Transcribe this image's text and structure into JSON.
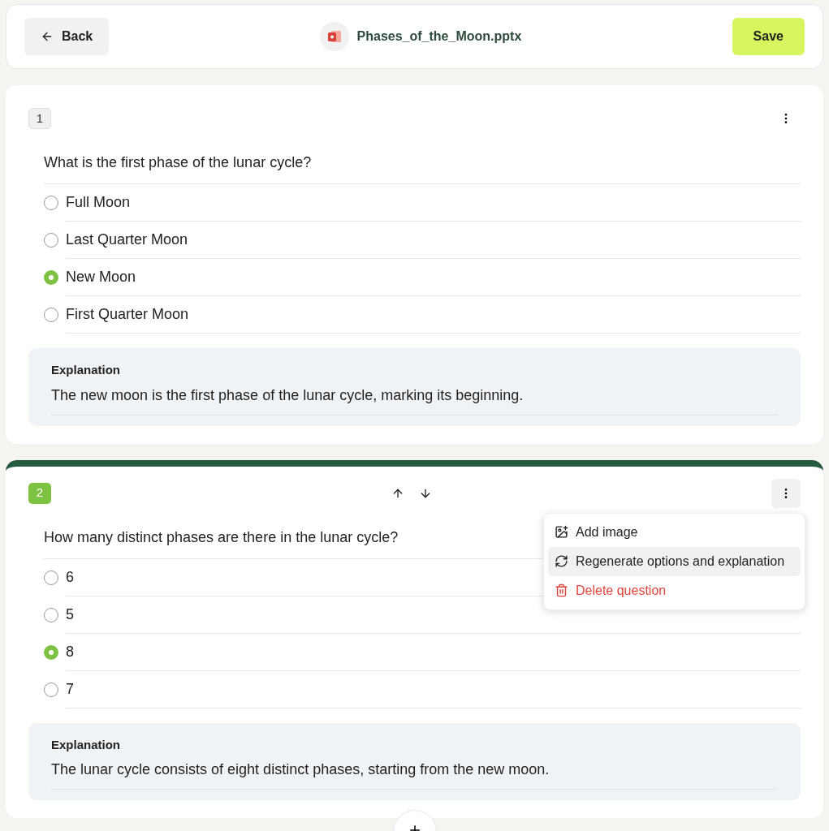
{
  "header": {
    "back": "Back",
    "file_name": "Phases_of_the_Moon.pptx",
    "save": "Save"
  },
  "questions": [
    {
      "number": "1",
      "active": false,
      "text": "What is the first phase of the lunar cycle?",
      "options": [
        {
          "label": "Full Moon",
          "selected": false
        },
        {
          "label": "Last Quarter Moon",
          "selected": false
        },
        {
          "label": "New Moon",
          "selected": true
        },
        {
          "label": "First Quarter Moon",
          "selected": false
        }
      ],
      "explanation_title": "Explanation",
      "explanation": "The new moon is the first phase of the lunar cycle, marking its beginning."
    },
    {
      "number": "2",
      "active": true,
      "text": "How many distinct phases are there in the lunar cycle?",
      "options": [
        {
          "label": "6",
          "selected": false
        },
        {
          "label": "5",
          "selected": false
        },
        {
          "label": "8",
          "selected": true
        },
        {
          "label": "7",
          "selected": false
        }
      ],
      "explanation_title": "Explanation",
      "explanation": "The lunar cycle consists of eight distinct phases, starting from the new moon.",
      "menu": [
        {
          "kind": "image",
          "label": "Add image",
          "selected": false
        },
        {
          "kind": "regenerate",
          "label": "Regenerate options and explanation",
          "selected": true
        },
        {
          "kind": "delete",
          "label": "Delete question",
          "selected": false
        }
      ]
    }
  ]
}
